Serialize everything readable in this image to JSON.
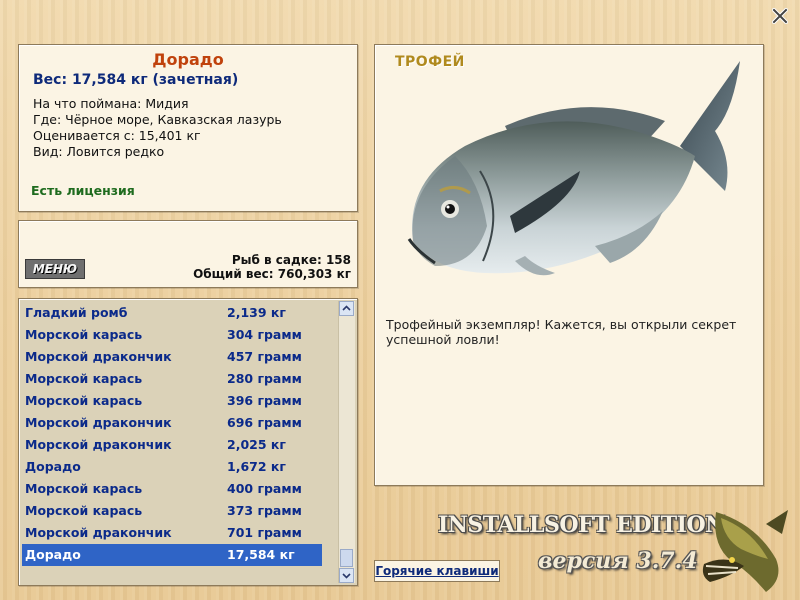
{
  "info": {
    "fish_name": "Дорадо",
    "weight_line": "Вес: 17,584 кг (зачетная)",
    "caught_with": "На что поймана: Мидия",
    "where": "Где: Чёрное море, Кавказская лазурь",
    "valued_from": "Оценивается с: 15,401 кг",
    "kind": "Вид: Ловится редко",
    "license": "Есть лицензия"
  },
  "stats": {
    "menu_label": "МЕНЮ",
    "fish_count": "Рыб в садке: 158",
    "total_weight": "Общий вес: 760,303 кг"
  },
  "catch_list": {
    "rows": [
      {
        "name": "Гладкий ромб",
        "weight": "2,139 кг"
      },
      {
        "name": "Морской карась",
        "weight": "304 грамм"
      },
      {
        "name": "Морской дракончик",
        "weight": "457 грамм"
      },
      {
        "name": "Морской карась",
        "weight": "280 грамм"
      },
      {
        "name": "Морской карась",
        "weight": "396 грамм"
      },
      {
        "name": "Морской дракончик",
        "weight": "696 грамм"
      },
      {
        "name": "Морской дракончик",
        "weight": "2,025 кг"
      },
      {
        "name": "Дорадо",
        "weight": "1,672 кг"
      },
      {
        "name": "Морской карась",
        "weight": "400 грамм"
      },
      {
        "name": "Морской карась",
        "weight": "373 грамм"
      },
      {
        "name": "Морской дракончик",
        "weight": "701 грамм"
      },
      {
        "name": "Дорадо",
        "weight": "17,584 кг"
      }
    ],
    "selected_index": 11
  },
  "trophy": {
    "title": "ТРОФЕЙ",
    "text": "Трофейный экземпляр! Кажется, вы открыли секрет успешной ловли!"
  },
  "footer": {
    "brand": "INSTALLSOFT EDITION",
    "version": "версия 3.7.4",
    "hotkeys_label": "Горячие клавиши"
  },
  "icons": {
    "close": "close-icon",
    "fish_image": "dorado-fish-image",
    "logo": "pike-logo"
  },
  "colors": {
    "title_orange": "#c0420c",
    "link_blue": "#0e2a7a",
    "license_green": "#1e6b1e",
    "selection_blue": "#2f64c6",
    "trophy_gold": "#b08a1e"
  }
}
